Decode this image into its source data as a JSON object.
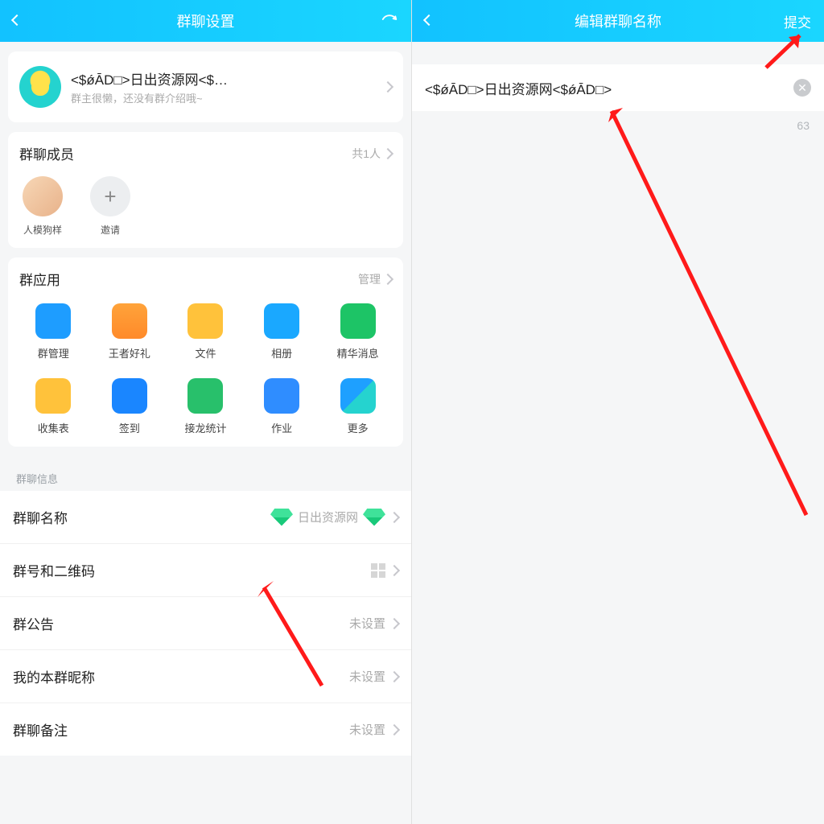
{
  "left": {
    "header": {
      "title": "群聊设置"
    },
    "group": {
      "name": "<$ǿĀD□>日出资源网<$…",
      "sub": "群主很懒，还没有群介绍哦~"
    },
    "members": {
      "title": "群聊成员",
      "count_label": "共1人",
      "items": [
        {
          "name": "人模狗样"
        },
        {
          "name": "邀请",
          "add": true
        }
      ]
    },
    "apps": {
      "title": "群应用",
      "manage": "管理",
      "items": [
        {
          "label": "群管理",
          "cls": "ic-blue"
        },
        {
          "label": "王者好礼",
          "cls": "ic-orange"
        },
        {
          "label": "文件",
          "cls": "ic-yellow"
        },
        {
          "label": "相册",
          "cls": "ic-teal"
        },
        {
          "label": "精华消息",
          "cls": "ic-green"
        },
        {
          "label": "收集表",
          "cls": "ic-yellow"
        },
        {
          "label": "签到",
          "cls": "ic-deep"
        },
        {
          "label": "接龙统计",
          "cls": "ic-lime"
        },
        {
          "label": "作业",
          "cls": "ic-blu2"
        },
        {
          "label": "更多",
          "cls": "ic-tiles"
        }
      ]
    },
    "section_info": "群聊信息",
    "settings": {
      "chat_name": {
        "label": "群聊名称",
        "value": "日出资源网"
      },
      "qr": {
        "label": "群号和二维码",
        "value": ""
      },
      "notice": {
        "label": "群公告",
        "value": "未设置"
      },
      "my_nick": {
        "label": "我的本群昵称",
        "value": "未设置"
      },
      "remark": {
        "label": "群聊备注",
        "value": "未设置"
      }
    }
  },
  "right": {
    "header": {
      "title": "编辑群聊名称",
      "submit": "提交"
    },
    "input_value": "<$ǿĀD□>日出资源网<$ǿĀD□>",
    "char_count": "63"
  }
}
